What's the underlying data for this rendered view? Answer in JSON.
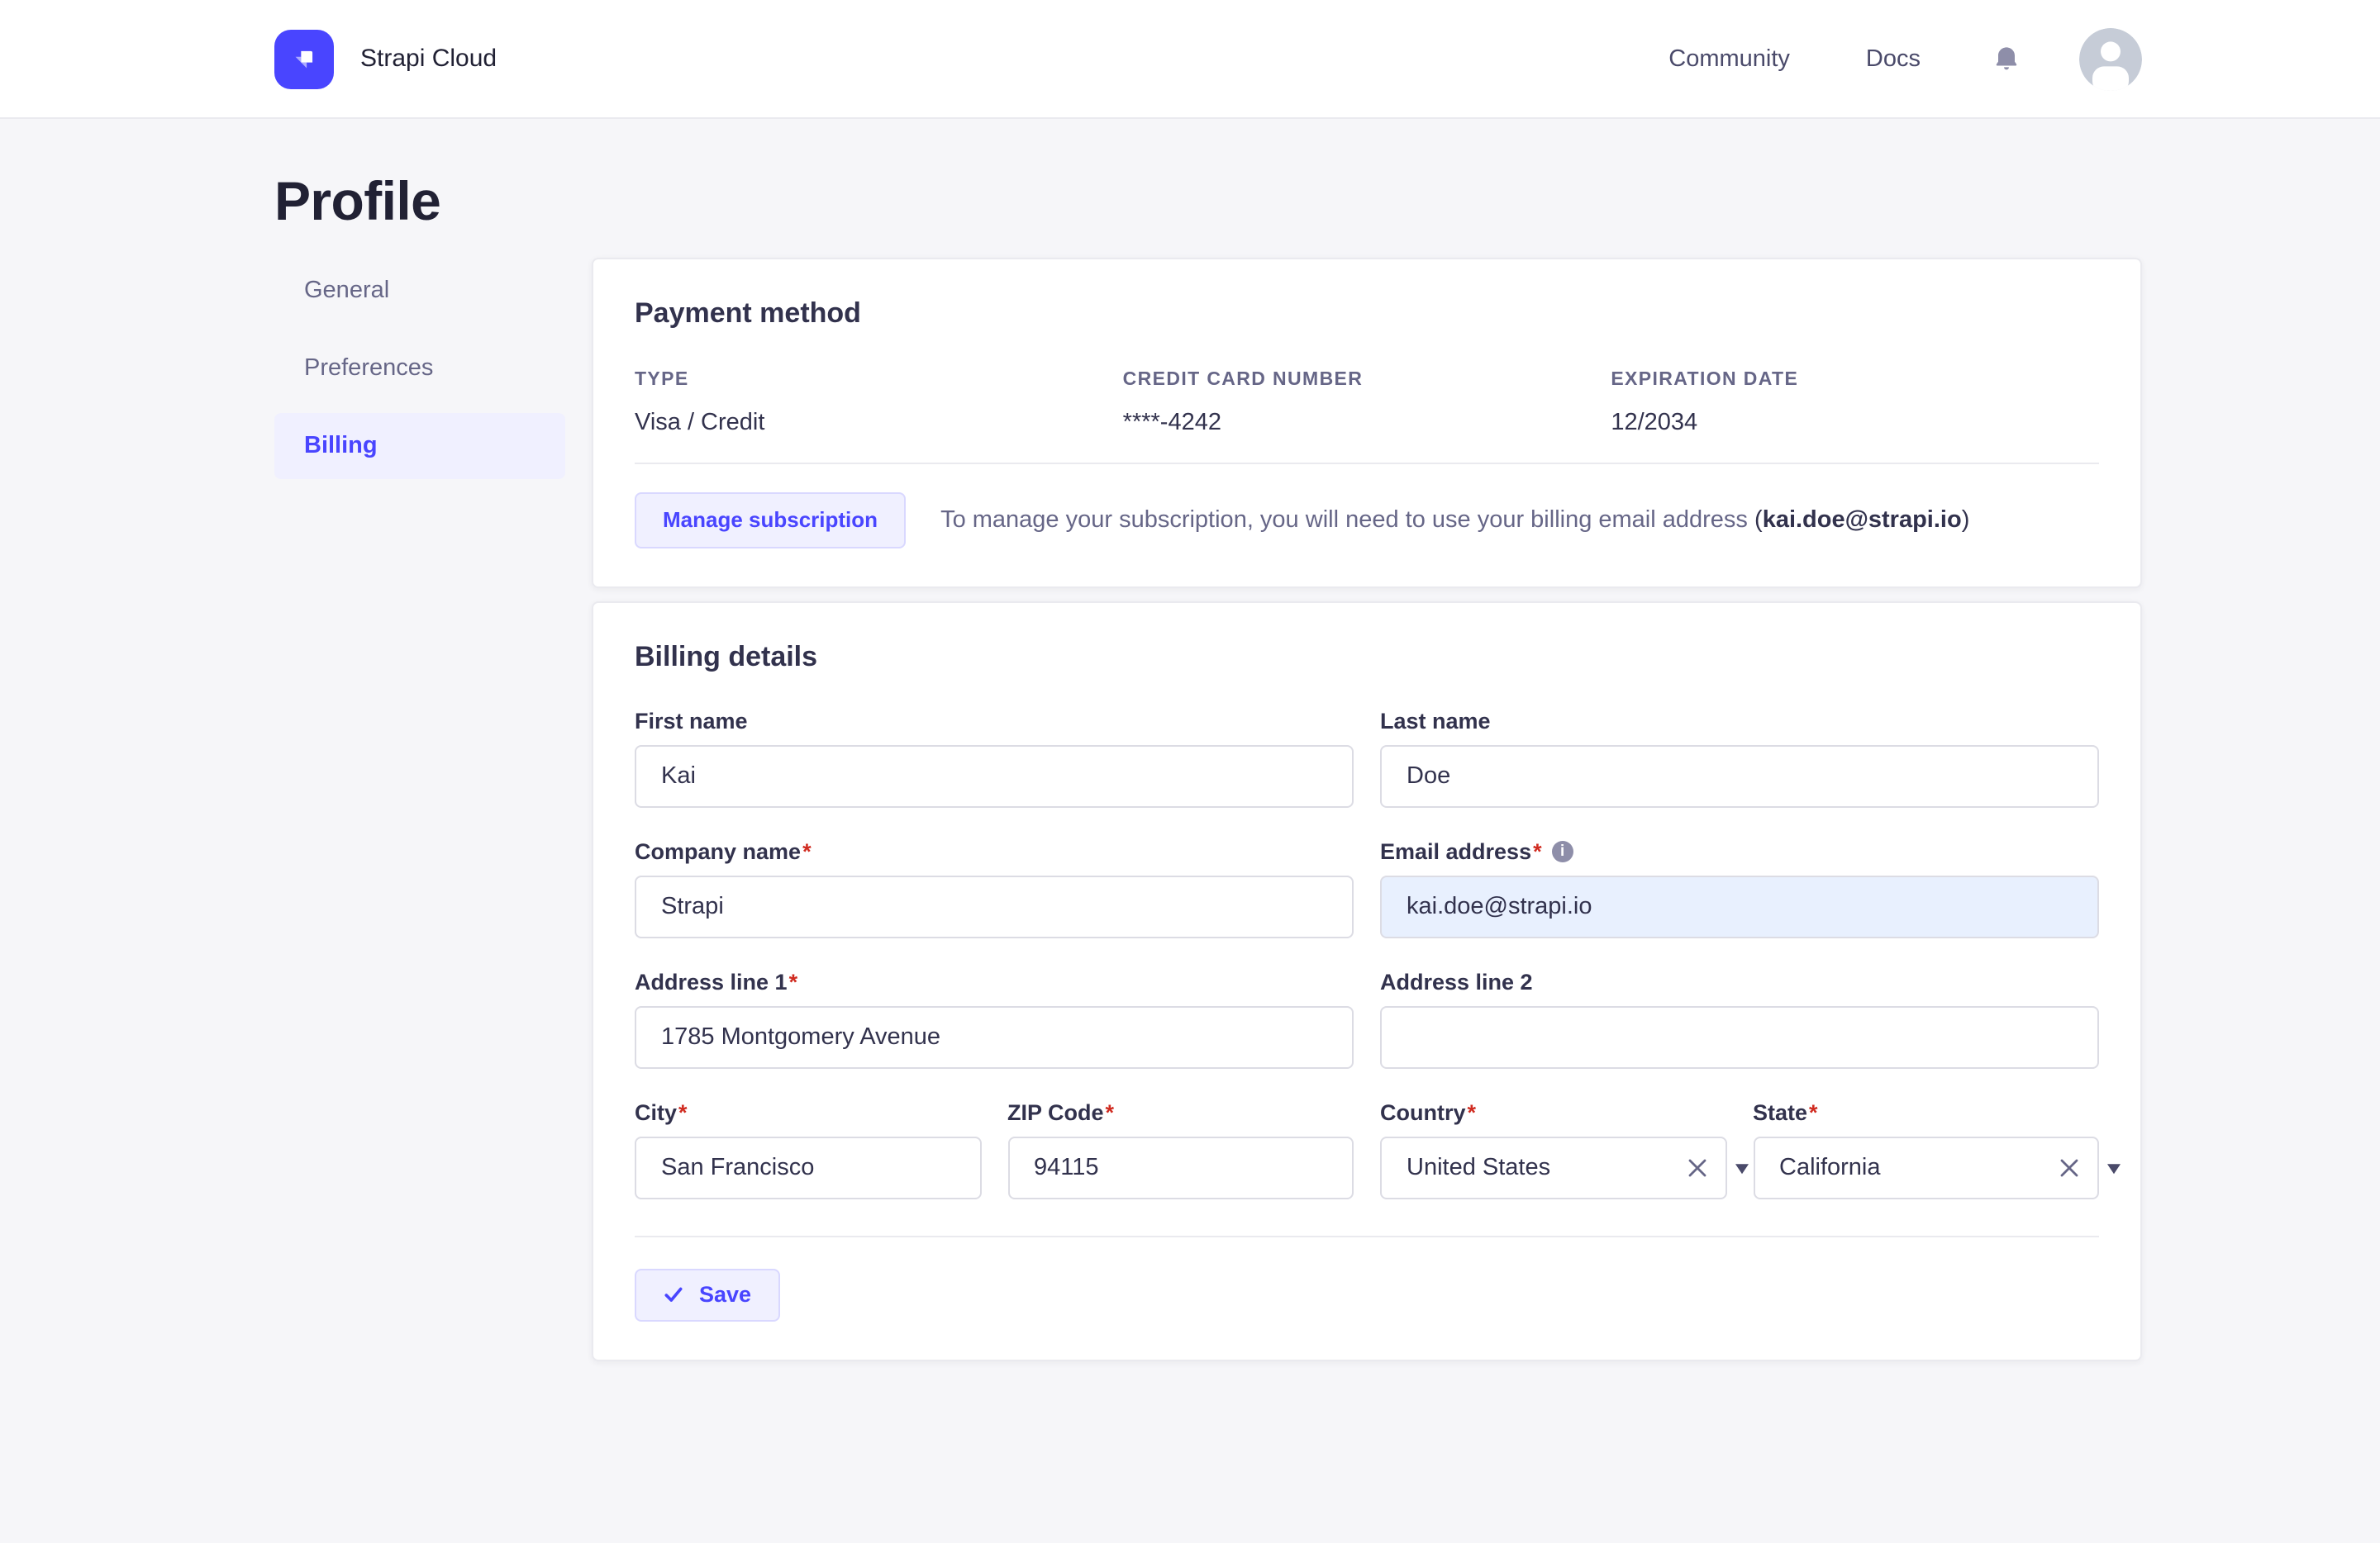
{
  "header": {
    "brand": "Strapi Cloud",
    "nav": [
      {
        "label": "Community"
      },
      {
        "label": "Docs"
      }
    ]
  },
  "page": {
    "title": "Profile"
  },
  "sidebar": {
    "items": [
      {
        "label": "General",
        "active": false
      },
      {
        "label": "Preferences",
        "active": false
      },
      {
        "label": "Billing",
        "active": true
      }
    ]
  },
  "payment_method": {
    "title": "Payment method",
    "fields": [
      {
        "label": "TYPE",
        "value": "Visa / Credit"
      },
      {
        "label": "CREDIT CARD NUMBER",
        "value": "****-4242"
      },
      {
        "label": "EXPIRATION DATE",
        "value": "12/2034"
      }
    ],
    "manage_button": "Manage subscription",
    "note_prefix": "To manage your subscription, you will need to use your billing email address ",
    "note_open": "(",
    "note_email": "kai.doe@strapi.io",
    "note_close": ")"
  },
  "billing_details": {
    "title": "Billing details",
    "fields": {
      "first_name": {
        "label": "First name",
        "value": "Kai",
        "required": false
      },
      "last_name": {
        "label": "Last name",
        "value": "Doe",
        "required": false
      },
      "company": {
        "label": "Company name",
        "value": "Strapi",
        "required": true
      },
      "email": {
        "label": "Email address",
        "value": "kai.doe@strapi.io",
        "required": true
      },
      "address1": {
        "label": "Address line 1",
        "value": "1785 Montgomery Avenue",
        "required": true
      },
      "address2": {
        "label": "Address line 2",
        "value": "",
        "required": false
      },
      "city": {
        "label": "City",
        "value": "San Francisco",
        "required": true
      },
      "zip": {
        "label": "ZIP Code",
        "value": "94115",
        "required": true
      },
      "country": {
        "label": "Country",
        "value": "United States",
        "required": true
      },
      "state": {
        "label": "State",
        "value": "California",
        "required": true
      }
    },
    "save_button": "Save"
  },
  "colors": {
    "accent": "#4945ff",
    "accent_bg": "#f0f0ff",
    "accent_border": "#d9d8ff",
    "required_asterisk": "#d02b20",
    "autofill_bg": "#e8f0fe",
    "page_bg": "#f6f6f9",
    "text_dark": "#32324d",
    "text_muted": "#666687"
  }
}
